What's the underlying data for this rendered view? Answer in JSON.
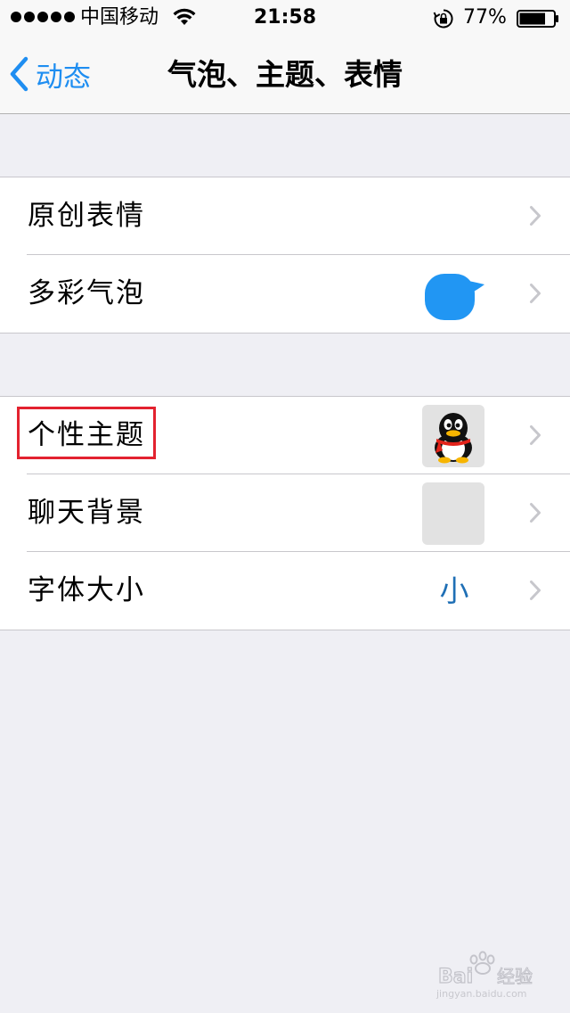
{
  "status_bar": {
    "carrier": "中国移动",
    "time": "21:58",
    "battery_percent": "77%",
    "battery_level": 0.77,
    "icons": [
      "signal-dots",
      "wifi-icon",
      "rotation-lock-icon",
      "battery-icon"
    ]
  },
  "nav": {
    "back_label": "动态",
    "title": "气泡、主题、表情"
  },
  "accent_color": "#1f8ef1",
  "groups": [
    {
      "rows": [
        {
          "label": "原创表情"
        },
        {
          "label": "多彩气泡",
          "accessory": "chat-bubble-icon",
          "accessory_color": "#2196f3"
        }
      ]
    },
    {
      "rows": [
        {
          "label": "个性主题",
          "accessory": "qq-penguin-icon",
          "highlighted": true,
          "highlight_color": "#e3222f"
        },
        {
          "label": "聊天背景",
          "accessory": "blank-thumbnail"
        },
        {
          "label": "字体大小",
          "value": "小",
          "value_color": "#1f6fb5"
        }
      ]
    }
  ],
  "watermark": "Baidu 经验 jingyan.baidu.com"
}
